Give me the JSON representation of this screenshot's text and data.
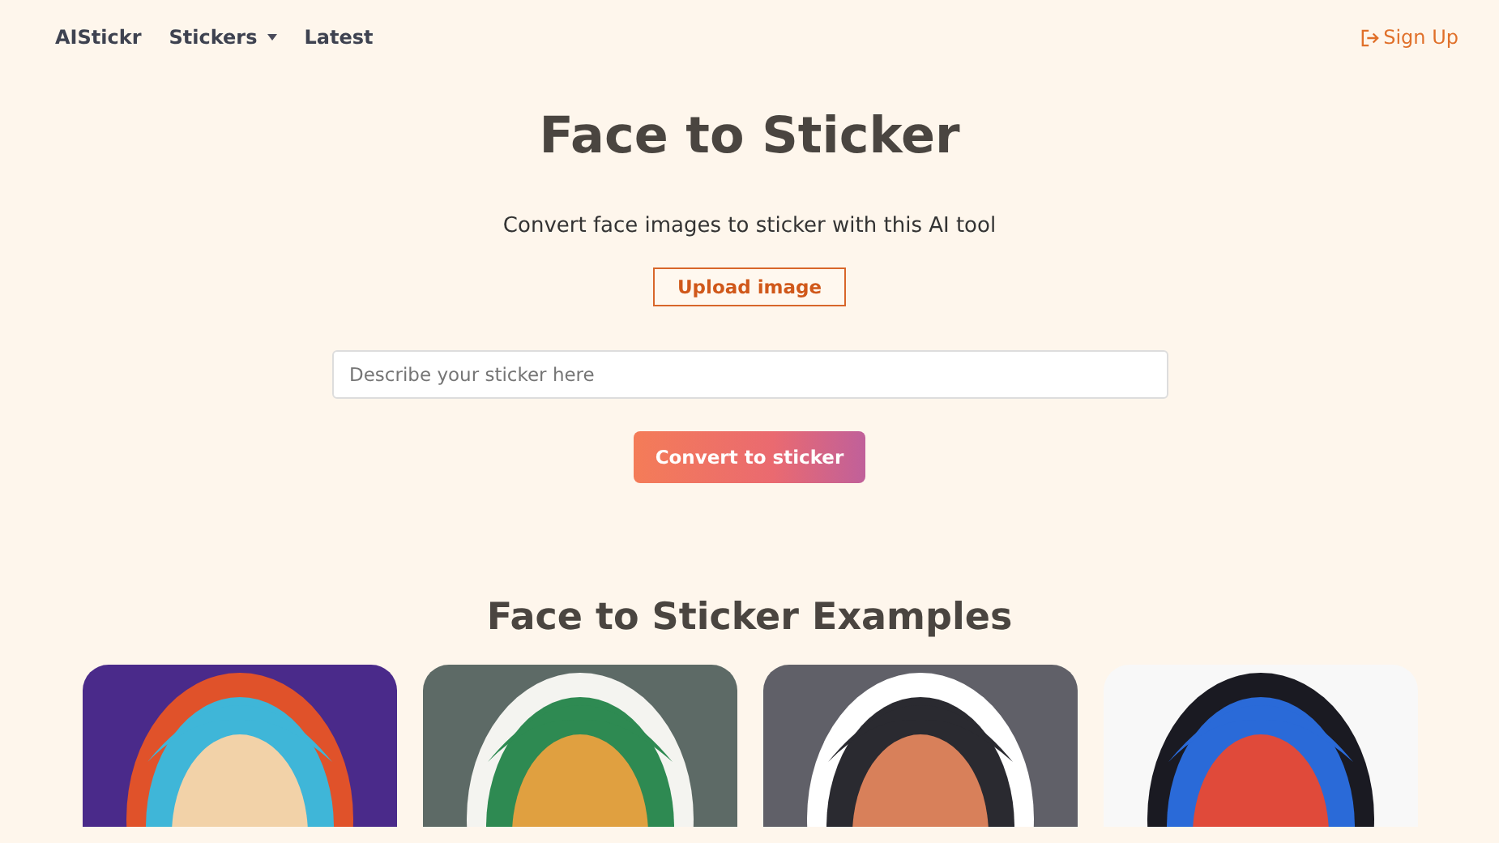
{
  "nav": {
    "brand": "AIStickr",
    "items": [
      {
        "label": "Stickers",
        "kind": "dropdown"
      },
      {
        "label": "Latest",
        "kind": "link"
      }
    ],
    "signup": "Sign Up"
  },
  "hero": {
    "title": "Face to Sticker",
    "subtitle": "Convert face images to sticker with this AI tool",
    "upload": "Upload image",
    "placeholder": "Describe your sticker here",
    "convert": "Convert to sticker"
  },
  "examples": {
    "title": "Face to Sticker Examples"
  }
}
